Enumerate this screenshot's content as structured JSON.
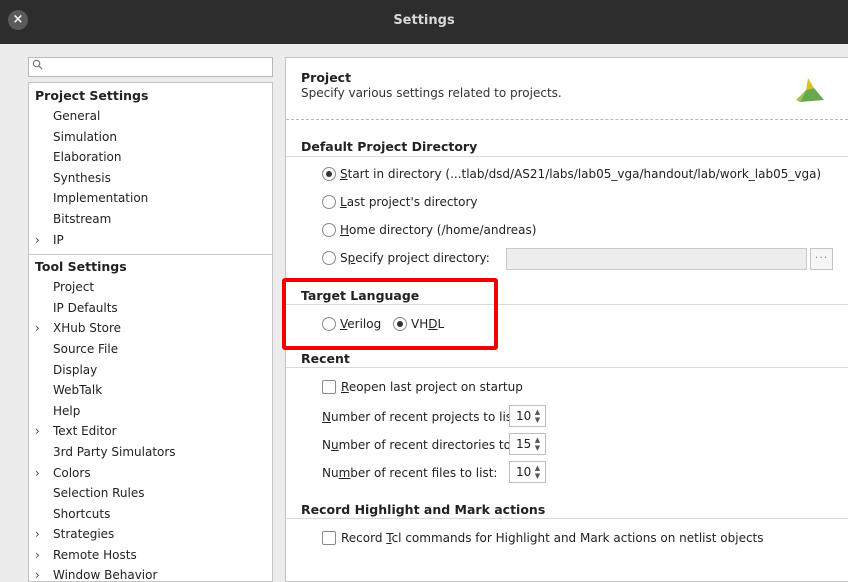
{
  "window": {
    "title": "Settings",
    "close_glyph": "×"
  },
  "search": {
    "placeholder": "",
    "icon": "search-icon"
  },
  "tree": {
    "project_settings_label": "Project Settings",
    "project_items": [
      "General",
      "Simulation",
      "Elaboration",
      "Synthesis",
      "Implementation",
      "Bitstream"
    ],
    "ip_label": "IP",
    "tool_settings_label": "Tool Settings",
    "tool_items": [
      {
        "label": "Project",
        "expandable": false
      },
      {
        "label": "IP Defaults",
        "expandable": false
      },
      {
        "label": "XHub Store",
        "expandable": true
      },
      {
        "label": "Source File",
        "expandable": false
      },
      {
        "label": "Display",
        "expandable": false
      },
      {
        "label": "WebTalk",
        "expandable": false
      },
      {
        "label": "Help",
        "expandable": false
      },
      {
        "label": "Text Editor",
        "expandable": true
      },
      {
        "label": "3rd Party Simulators",
        "expandable": false
      },
      {
        "label": "Colors",
        "expandable": true
      },
      {
        "label": "Selection Rules",
        "expandable": false
      },
      {
        "label": "Shortcuts",
        "expandable": false
      },
      {
        "label": "Strategies",
        "expandable": true
      },
      {
        "label": "Remote Hosts",
        "expandable": true
      },
      {
        "label": "Window Behavior",
        "expandable": true
      }
    ],
    "chevron": "›"
  },
  "header": {
    "title": "Project",
    "description": "Specify various settings related to projects."
  },
  "default_dir": {
    "title": "Default Project Directory",
    "start_in": {
      "key": "S",
      "rest": "tart in directory (...tlab/dsd/AS21/labs/lab05_vga/handout/lab/work_lab05_vga)"
    },
    "last_project": {
      "key": "L",
      "rest": "ast project's directory"
    },
    "home": {
      "key": "H",
      "rest": "ome directory (/home/andreas)"
    },
    "specify": {
      "pre": "S",
      "key": "p",
      "rest": "ecify project directory:"
    },
    "browse_label": "···"
  },
  "target_language": {
    "title": "Target Language",
    "verilog": {
      "key": "V",
      "rest": "erilog"
    },
    "vhdl": {
      "pre": "VH",
      "key": "D",
      "rest": "L"
    }
  },
  "recent": {
    "title": "Recent",
    "reopen": {
      "key": "R",
      "rest": "eopen last project on startup"
    },
    "projects": {
      "key": "N",
      "rest": "umber of recent projects to list:",
      "value": "10"
    },
    "directories": {
      "pre": "N",
      "key": "u",
      "rest": "mber of recent directories to list:",
      "value": "15"
    },
    "files": {
      "pre": "Nu",
      "key": "m",
      "rest": "ber of recent files to list:",
      "value": "10"
    }
  },
  "record": {
    "title": "Record Highlight and Mark actions",
    "cmd": {
      "pre": "Record ",
      "key": "T",
      "rest": "cl commands for Highlight and Mark actions on netlist objects"
    }
  },
  "colors": {
    "highlight": "#f00000",
    "logo_yellow": "#d8c21e",
    "logo_green": "#6aa84f"
  }
}
